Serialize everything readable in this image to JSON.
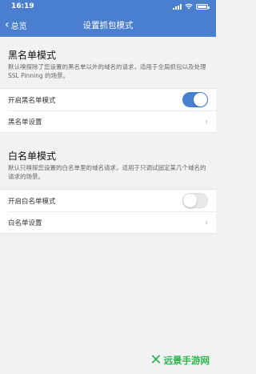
{
  "status_bar": {
    "time": "16:19"
  },
  "nav": {
    "back_label": "总览",
    "title": "设置抓包模式"
  },
  "blacklist": {
    "title": "黑名单模式",
    "description": "默认嗅探除了您设置的黑名单以外的域名的请求，适用于全局抓包以及处理 SSL Pinning 的场景。",
    "toggle_label": "开启黑名单模式",
    "toggle_on": true,
    "settings_label": "黑名单设置"
  },
  "whitelist": {
    "title": "白名单模式",
    "description": "默认只嗅探您设置的白名单里的域名请求，适用于只调试固定某几个域名的请求的场景。",
    "toggle_label": "开启白名单模式",
    "toggle_on": false,
    "settings_label": "白名单设置"
  },
  "watermark": {
    "text": "远景手游网"
  },
  "colors": {
    "accent": "#4a7fcf",
    "background": "#f2f2f4",
    "watermark": "#2db34a"
  },
  "icons": [
    "signal-icon",
    "wifi-icon",
    "battery-icon",
    "chevron-left-icon",
    "chevron-right-icon"
  ]
}
